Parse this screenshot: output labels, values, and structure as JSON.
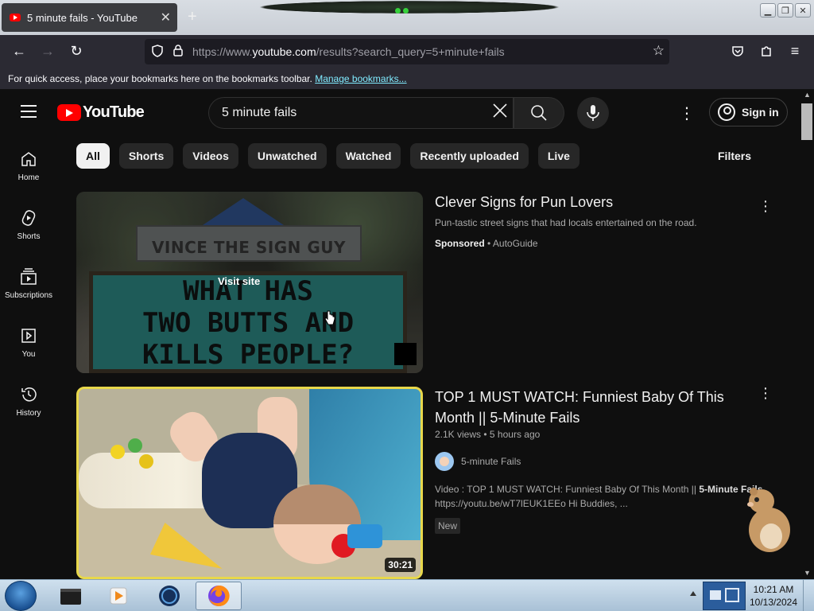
{
  "browser": {
    "tab_title": "5 minute fails - YouTube",
    "url_prefix": "https://www.",
    "url_domain": "youtube.com",
    "url_rest": "/results?search_query=5+minute+fails",
    "bookmarks_text": "For quick access, place your bookmarks here on the bookmarks toolbar.",
    "bookmarks_link": "Manage bookmarks..."
  },
  "youtube": {
    "logo_text": "YouTube",
    "search_query": "5 minute fails",
    "sign_in": "Sign in",
    "sidebar": [
      {
        "label": "Home",
        "icon": "home-icon"
      },
      {
        "label": "Shorts",
        "icon": "shorts-icon"
      },
      {
        "label": "Subscriptions",
        "icon": "subscriptions-icon"
      },
      {
        "label": "You",
        "icon": "you-icon"
      },
      {
        "label": "History",
        "icon": "history-icon"
      }
    ],
    "chips": [
      "All",
      "Shorts",
      "Videos",
      "Unwatched",
      "Watched",
      "Recently uploaded",
      "Live"
    ],
    "active_chip": "All",
    "filters": "Filters",
    "ad": {
      "title": "Clever Signs for Pun Lovers",
      "description": "Pun-tastic street signs that had locals entertained on the road.",
      "sponsored": "Sponsored",
      "separator": "•",
      "advertiser": "AutoGuide",
      "visit_site": "Visit site",
      "sign_top": "VINCE THE SIGN GUY",
      "sign_lines": [
        "WHAT HAS",
        "TWO BUTTS AND",
        "KILLS PEOPLE?"
      ]
    },
    "video": {
      "title": "TOP 1 MUST WATCH: Funniest Baby Of This Month || 5-Minute Fails",
      "views": "2.1K views",
      "separator": "•",
      "age": "5 hours ago",
      "channel": "5-minute Fails",
      "snippet_pre": "Video : TOP 1 MUST WATCH: Funniest Baby Of This Month || ",
      "snippet_bold": "5-Minute Fails",
      "snippet_post": " ...",
      "snippet_line2": "https://youtu.be/wT7lEUK1EEo Hi Buddies, ...",
      "badge": "New",
      "duration": "30:21"
    }
  },
  "taskbar": {
    "time": "10:21 AM",
    "date": "10/13/2024"
  }
}
